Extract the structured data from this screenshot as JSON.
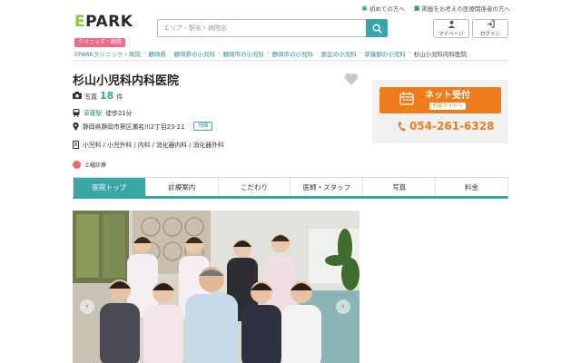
{
  "top_links": [
    {
      "label": "初めての方へ",
      "icon": "book-icon"
    },
    {
      "label": "掲載をお考えの医療関係者の方へ",
      "icon": "hospital-icon"
    }
  ],
  "logo": {
    "main_e": "E",
    "main_rest": "PARK",
    "sub": "クリニック・病院"
  },
  "search": {
    "placeholder": "エリア・駅名・病院名"
  },
  "user_buttons": [
    {
      "label": "マイページ",
      "icon": "user-icon"
    },
    {
      "label": "ログイン",
      "icon": "login-icon"
    }
  ],
  "breadcrumb": [
    "EPARKクリニック・病院",
    "静岡県",
    "静岡県の小児科",
    "静岡市の小児科",
    "静岡市の小児科",
    "葵区の小児科",
    "草薙駅の小児科",
    "杉山小児科内科医院"
  ],
  "clinic": {
    "name": "杉山小児科内科医院",
    "photo_label": "写真",
    "photo_count": "18",
    "photo_unit": "件",
    "station_link": "草薙駅",
    "station_walk": "徒歩21分",
    "address": "静岡県静岡市葵区瀬名川2丁目23-21",
    "map_label": "地図",
    "departments": "小児科 / 小児外科 / 内科 / 消化器内科 / 消化器外科",
    "saturday": "土曜診療"
  },
  "reserve": {
    "main": "ネット受付",
    "sub": "外部サイトへ",
    "phone": "054-261-6328"
  },
  "tabs": [
    "医院トップ",
    "診療案内",
    "こだわり",
    "医師・スタッフ",
    "写真",
    "料金"
  ],
  "colors": {
    "accent": "#3aa6a6",
    "orange": "#ef7c1a",
    "logo_green": "#8cc63f",
    "logo_pink": "#ec6a8a"
  }
}
